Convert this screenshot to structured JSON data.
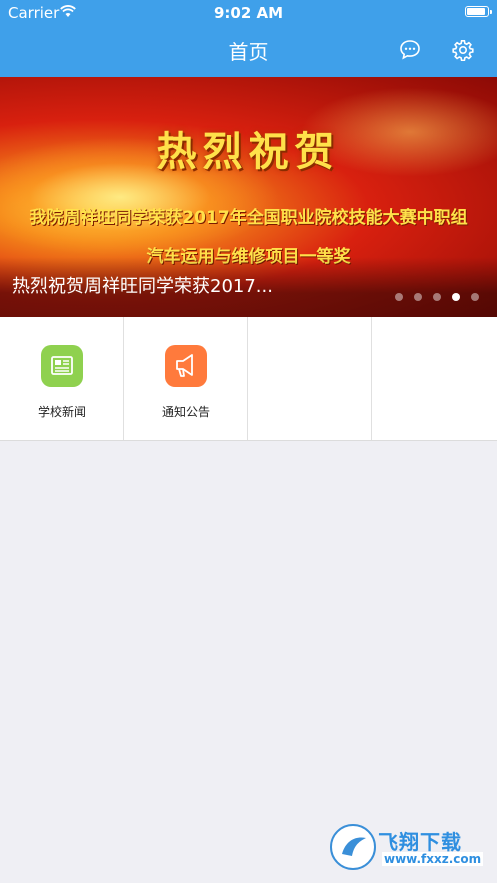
{
  "status_bar": {
    "carrier": "Carrier",
    "time": "9:02 AM",
    "battery_level": 1.0
  },
  "nav": {
    "title": "首页",
    "icons": [
      "chat-bubble-icon",
      "gear-icon"
    ]
  },
  "banner": {
    "headline": "热烈祝贺",
    "line1": "我院周祥旺同学荣获2017年全国职业院校技能大赛中职组",
    "line2": "汽车运用与维修项目一等奖",
    "caption": "热烈祝贺周祥旺同学荣获2017...",
    "page_count": 5,
    "active_page": 4
  },
  "grid": {
    "items": [
      {
        "label": "学校新闻",
        "icon": "news-icon",
        "color": "#8fd14f"
      },
      {
        "label": "通知公告",
        "icon": "megaphone-icon",
        "color": "#ff7a3c"
      }
    ]
  },
  "watermark": {
    "title": "飞翔下载",
    "url": "www.fxxz.com"
  },
  "colors": {
    "primary": "#3fa0ea",
    "background": "#efeff4"
  }
}
